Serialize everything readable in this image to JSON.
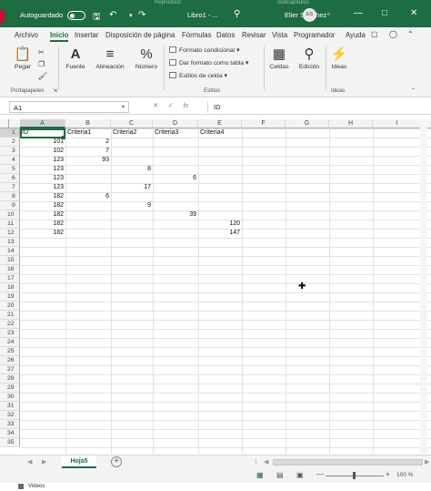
{
  "titlebar": {
    "ghost_left": "Reproducir",
    "ghost_right": "Subcapítulos",
    "autosave_label": "Autoguardado",
    "doc_title": "Libro1 - ...",
    "user_name": "Elier Sánchez",
    "avatar_initials": "ES",
    "accent_color": "#1e6c41"
  },
  "tabs": [
    "Archivo",
    "Inicio",
    "Insertar",
    "Disposición de página",
    "Fórmulas",
    "Datos",
    "Revisar",
    "Vista",
    "Programador",
    "Ayuda"
  ],
  "ribbon": {
    "paste": "Pegar",
    "clipboard_group": "Portapapeles",
    "font": "Fuente",
    "alignment": "Alineación",
    "number": "Número",
    "styles_items": [
      "Formato condicional",
      "Dar formato como tabla",
      "Estilos de celda"
    ],
    "styles_group": "Estilos",
    "cells": "Celdas",
    "editing": "Edición",
    "ideas": "Ideas",
    "ideas_group": "Ideas"
  },
  "formula_bar": {
    "name_box": "A1",
    "fx": "fx",
    "value": "ID"
  },
  "grid": {
    "columns": [
      "A",
      "B",
      "C",
      "D",
      "E",
      "F",
      "G",
      "H",
      "I"
    ],
    "rows": [
      "1",
      "2",
      "3",
      "4",
      "5",
      "6",
      "7",
      "8",
      "9",
      "10",
      "11",
      "12",
      "13",
      "14",
      "15",
      "16",
      "17",
      "18",
      "19",
      "20",
      "21",
      "22",
      "23",
      "24",
      "25",
      "26",
      "27",
      "28",
      "29",
      "30",
      "31",
      "32",
      "33",
      "34",
      "35"
    ],
    "headers": [
      "ID",
      "Criteria1",
      "Criteria2",
      "Criteria3",
      "Criteria4"
    ],
    "data": [
      [
        "101",
        "2",
        "",
        "",
        ""
      ],
      [
        "102",
        "7",
        "",
        "",
        ""
      ],
      [
        "123",
        "93",
        "",
        "",
        ""
      ],
      [
        "123",
        "",
        "8",
        "",
        ""
      ],
      [
        "123",
        "",
        "",
        "6",
        ""
      ],
      [
        "123",
        "",
        "17",
        "",
        ""
      ],
      [
        "182",
        "6",
        "",
        "",
        ""
      ],
      [
        "182",
        "",
        "9",
        "",
        ""
      ],
      [
        "182",
        "",
        "",
        "39",
        ""
      ],
      [
        "182",
        "",
        "",
        "",
        "120"
      ],
      [
        "182",
        "",
        "",
        "",
        "147"
      ]
    ]
  },
  "sheetbar": {
    "sheet_name": "Hoja5",
    "add_sheet": "+"
  },
  "statusbar": {
    "zoom": "100 %"
  },
  "taskbar": {
    "label": "Videos"
  }
}
